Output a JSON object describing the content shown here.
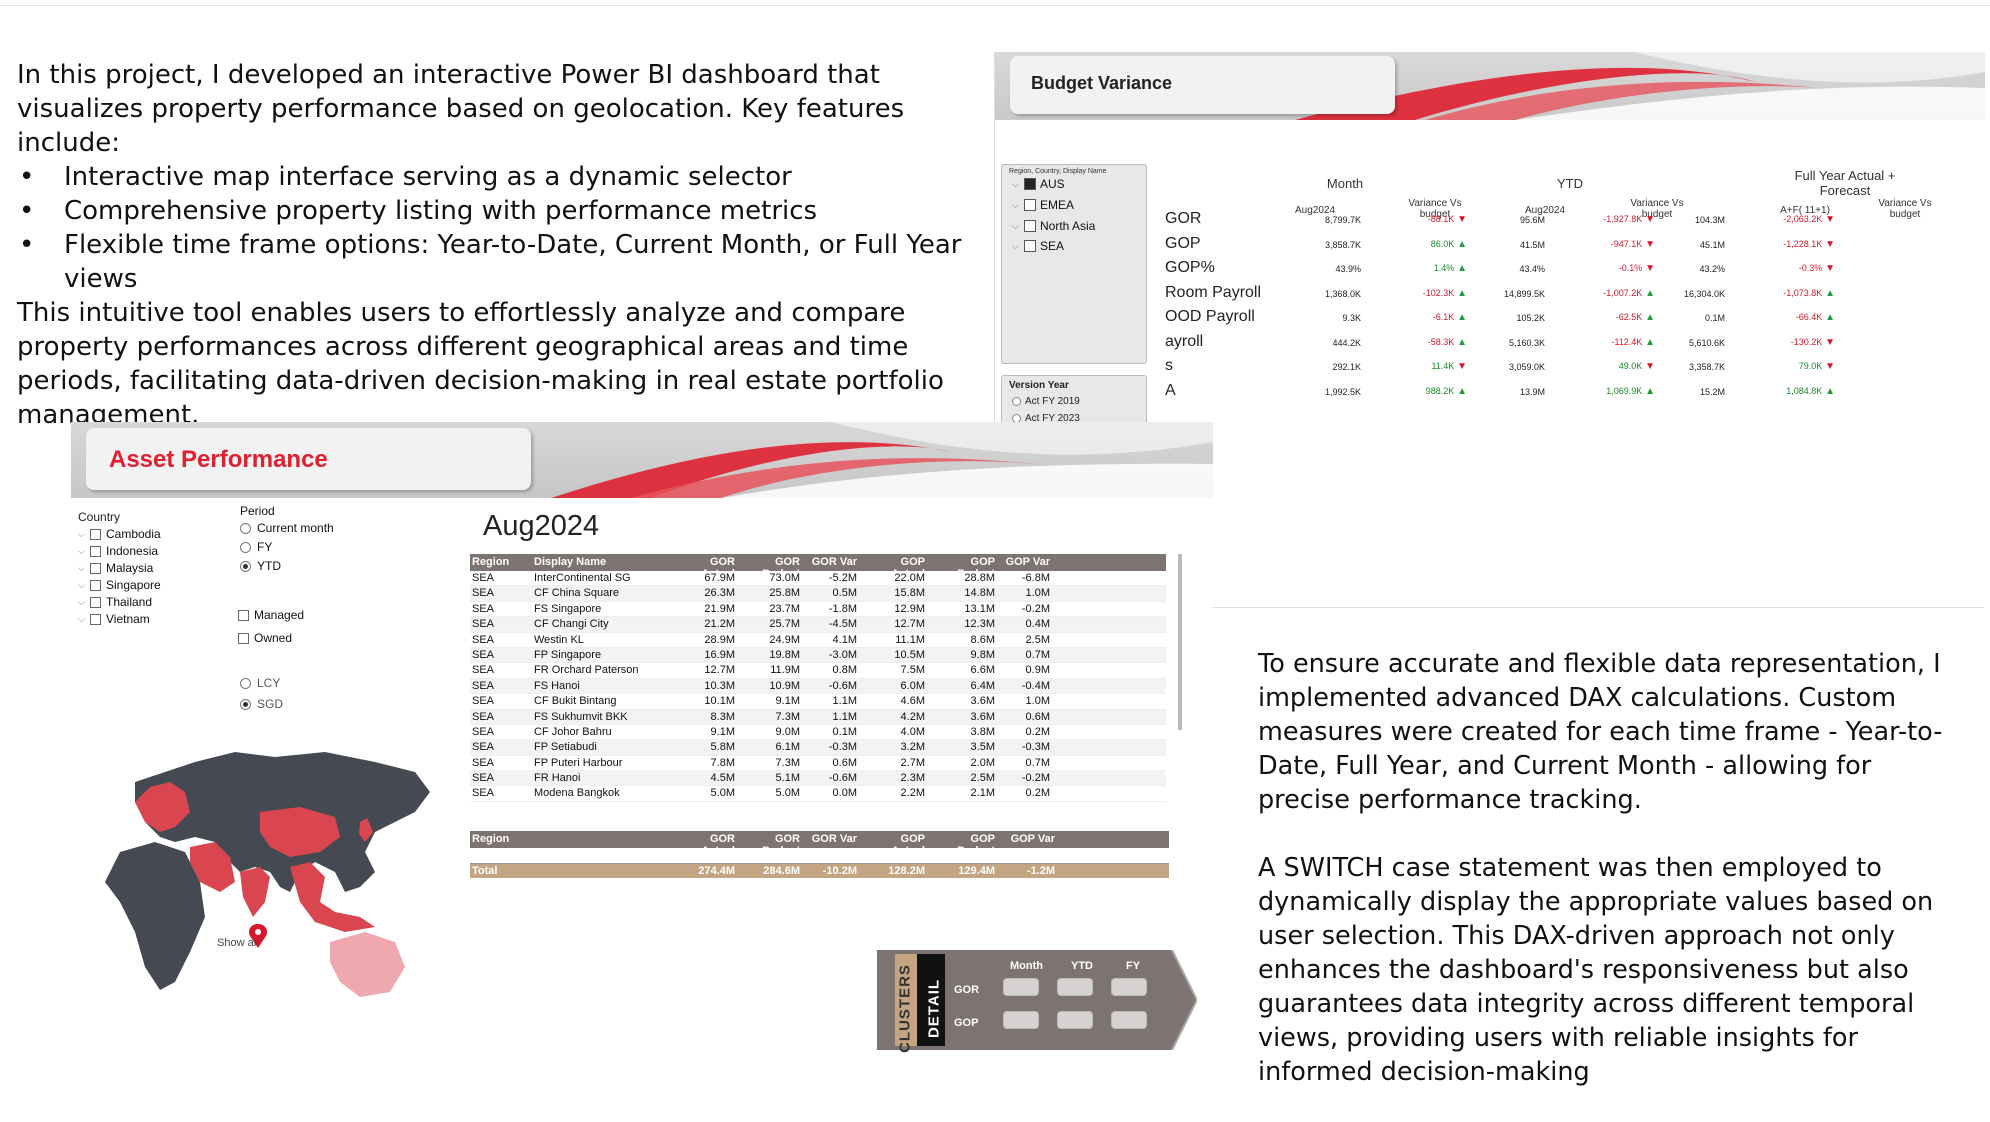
{
  "intro": {
    "lead": "In this project, I developed an interactive Power BI dashboard that visualizes property performance based on geolocation. Key features include:",
    "bullets": [
      "Interactive map interface serving as a dynamic selector",
      "Comprehensive property listing with performance metrics",
      "Flexible time frame options: Year-to-Date, Current Month, or Full Year views"
    ],
    "closing": "This intuitive tool enables users to effortlessly analyze and compare property performances across different geographical areas and time periods, facilitating data-driven decision-making in real estate portfolio management."
  },
  "explain": {
    "p1": "To ensure accurate and flexible data representation, I implemented advanced DAX calculations. Custom measures were created for each time frame - Year-to-Date, Full Year, and Current Month - allowing for precise performance tracking.",
    "p2": "A SWITCH case statement was then employed to dynamically display the appropriate values based on user selection. This DAX-driven approach not only enhances the dashboard's responsiveness but also guarantees data integrity across different temporal views, providing users with reliable insights for informed decision-making"
  },
  "budget_variance": {
    "title": "Budget Variance",
    "slicer_head": "Region, Country, Display Name",
    "regions": [
      "AUS",
      "EMEA",
      "North Asia",
      "SEA"
    ],
    "version_head": "Version Year",
    "versions": [
      "Act FY 2019",
      "Act FY 2023"
    ],
    "groups": {
      "month": "Month",
      "ytd": "YTD",
      "fy": "Full Year Actual + Forecast"
    },
    "cols": {
      "m_val": "Aug2024",
      "m_var": "Variance Vs budget",
      "y_val": "Aug2024",
      "y_var": "Variance Vs budget",
      "f_val": "A+F( 11+1)",
      "f_var": "Variance Vs budget"
    },
    "rows": [
      {
        "label": "GOR",
        "m": "8,799.7K",
        "mv": "-88.1K",
        "md": "down",
        "y": "95.6M",
        "yv": "-1,927.8K",
        "yd": "down",
        "f": "104.3M",
        "fv": "-2,063.2K",
        "fd": "down"
      },
      {
        "label": "GOP",
        "m": "3,858.7K",
        "mv": "86.0K",
        "md": "up",
        "y": "41.5M",
        "yv": "-947.1K",
        "yd": "down",
        "f": "45.1M",
        "fv": "-1,228.1K",
        "fd": "down"
      },
      {
        "label": "GOP%",
        "m": "43.9%",
        "mv": "1.4%",
        "md": "up",
        "y": "43.4%",
        "yv": "-0.1%",
        "yd": "down",
        "f": "43.2%",
        "fv": "-0.3%",
        "fd": "down"
      },
      {
        "label": "Room Payroll",
        "m": "1,368.0K",
        "mv": "-102.3K",
        "md": "up",
        "y": "14,899.5K",
        "yv": "-1,007.2K",
        "yd": "up",
        "f": "16,304.0K",
        "fv": "-1,073.8K",
        "fd": "up"
      },
      {
        "label": "OOD Payroll",
        "m": "9.3K",
        "mv": "-6.1K",
        "md": "up",
        "y": "105.2K",
        "yv": "-62.5K",
        "yd": "up",
        "f": "0.1M",
        "fv": "-66.4K",
        "fd": "up"
      },
      {
        "label": "ayroll",
        "m": "444.2K",
        "mv": "-58.3K",
        "md": "up",
        "y": "5,160.3K",
        "yv": "-112.4K",
        "yd": "up",
        "f": "5,610.6K",
        "fv": "-130.2K",
        "fd": "down"
      },
      {
        "label": "s",
        "m": "292.1K",
        "mv": "11.4K",
        "md": "down",
        "y": "3,059.0K",
        "yv": "49.0K",
        "yd": "down",
        "f": "3,358.7K",
        "fv": "79.0K",
        "fd": "down"
      },
      {
        "label": "A",
        "m": "1,992.5K",
        "mv": "988.2K",
        "md": "up",
        "y": "13.9M",
        "yv": "1,069.9K",
        "yd": "up",
        "f": "15.2M",
        "fv": "1,084.8K",
        "fd": "up"
      }
    ]
  },
  "asset_performance": {
    "title": "Asset Performance",
    "country_head": "Country",
    "countries": [
      "Cambodia",
      "Indonesia",
      "Malaysia",
      "Singapore",
      "Thailand",
      "Vietnam"
    ],
    "period_head": "Period",
    "periods": [
      "Current month",
      "FY",
      "YTD"
    ],
    "period_selected": "YTD",
    "ownership": [
      "Managed",
      "Owned"
    ],
    "currency": [
      "LCY",
      "SGD"
    ],
    "currency_selected": "SGD",
    "show_all": "Show all",
    "table_title": "Aug2024",
    "headers": [
      "Region",
      "Display Name",
      "GOR Actual",
      "GOR Budget",
      "GOR Var",
      "GOP Actual",
      "GOP Budget",
      "GOP Var"
    ],
    "rows": [
      [
        "SEA",
        "InterContinental SG",
        "67.9M",
        "73.0M",
        "-5.2M",
        "22.0M",
        "28.8M",
        "-6.8M"
      ],
      [
        "SEA",
        "CF China Square",
        "26.3M",
        "25.8M",
        "0.5M",
        "15.8M",
        "14.8M",
        "1.0M"
      ],
      [
        "SEA",
        "FS Singapore",
        "21.9M",
        "23.7M",
        "-1.8M",
        "12.9M",
        "13.1M",
        "-0.2M"
      ],
      [
        "SEA",
        "CF Changi City",
        "21.2M",
        "25.7M",
        "-4.5M",
        "12.7M",
        "12.3M",
        "0.4M"
      ],
      [
        "SEA",
        "Westin KL",
        "28.9M",
        "24.9M",
        "4.1M",
        "11.1M",
        "8.6M",
        "2.5M"
      ],
      [
        "SEA",
        "FP Singapore",
        "16.9M",
        "19.8M",
        "-3.0M",
        "10.5M",
        "9.8M",
        "0.7M"
      ],
      [
        "SEA",
        "FR Orchard Paterson",
        "12.7M",
        "11.9M",
        "0.8M",
        "7.5M",
        "6.6M",
        "0.9M"
      ],
      [
        "SEA",
        "FS Hanoi",
        "10.3M",
        "10.9M",
        "-0.6M",
        "6.0M",
        "6.4M",
        "-0.4M"
      ],
      [
        "SEA",
        "CF Bukit Bintang",
        "10.1M",
        "9.1M",
        "1.1M",
        "4.6M",
        "3.6M",
        "1.0M"
      ],
      [
        "SEA",
        "FS Sukhumvit BKK",
        "8.3M",
        "7.3M",
        "1.1M",
        "4.2M",
        "3.6M",
        "0.6M"
      ],
      [
        "SEA",
        "CF Johor Bahru",
        "9.1M",
        "9.0M",
        "0.1M",
        "4.0M",
        "3.8M",
        "0.2M"
      ],
      [
        "SEA",
        "FP Setiabudi",
        "5.8M",
        "6.1M",
        "-0.3M",
        "3.2M",
        "3.5M",
        "-0.3M"
      ],
      [
        "SEA",
        "FP Puteri Harbour",
        "7.8M",
        "7.3M",
        "0.6M",
        "2.7M",
        "2.0M",
        "0.7M"
      ],
      [
        "SEA",
        "FR Hanoi",
        "4.5M",
        "5.1M",
        "-0.6M",
        "2.3M",
        "2.5M",
        "-0.2M"
      ],
      [
        "SEA",
        "Modena Bangkok",
        "5.0M",
        "5.0M",
        "0.0M",
        "2.2M",
        "2.1M",
        "0.2M"
      ]
    ],
    "footer_headers": [
      "Region",
      "GOR Actual",
      "GOR Budget",
      "GOR Var",
      "GOP Actual",
      "GOP Budget",
      "GOP Var"
    ],
    "total": [
      "Total",
      "274.4M",
      "284.6M",
      "-10.2M",
      "128.2M",
      "129.4M",
      "-1.2M"
    ],
    "nav": {
      "clusters": "CLUSTERS",
      "detail": "DETAIL",
      "cols": [
        "Month",
        "YTD",
        "FY"
      ],
      "rows": [
        "GOR",
        "GOP"
      ]
    }
  },
  "colors": {
    "accent_red": "#e02030",
    "header_brown": "#7d7370",
    "total_tan": "#c3a583",
    "map_dark": "#454a52",
    "map_red": "#d9464f",
    "map_pink": "#efa8ae"
  }
}
